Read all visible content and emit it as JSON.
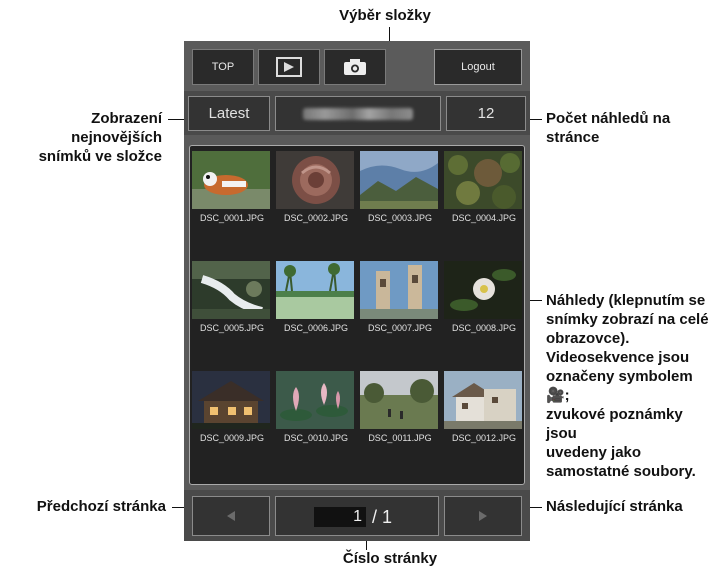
{
  "annotations": {
    "folder_select": "Výběr složky",
    "latest": [
      "Zobrazení nejnovějších",
      "snímků ve složce"
    ],
    "count": [
      "Počet náhledů na",
      "stránce"
    ],
    "thumbnails": [
      "Náhledy (klepnutím se",
      "snímky zobrazí na celé",
      "obrazovce).",
      "Videosekvence jsou",
      "označeny symbolem 🎥;",
      "zvukové poznámky jsou",
      "uvedeny jako",
      "samostatné soubory."
    ],
    "prev_page": "Předchozí stránka",
    "next_page": "Následující stránka",
    "page_number": "Číslo stránky"
  },
  "topbar": {
    "top_label": "TOP",
    "logout_label": "Logout"
  },
  "controls": {
    "latest_label": "Latest",
    "count_value": "12"
  },
  "thumbnails": [
    {
      "file": "DSC_0001.JPG"
    },
    {
      "file": "DSC_0002.JPG"
    },
    {
      "file": "DSC_0003.JPG"
    },
    {
      "file": "DSC_0004.JPG"
    },
    {
      "file": "DSC_0005.JPG"
    },
    {
      "file": "DSC_0006.JPG"
    },
    {
      "file": "DSC_0007.JPG"
    },
    {
      "file": "DSC_0008.JPG"
    },
    {
      "file": "DSC_0009.JPG"
    },
    {
      "file": "DSC_0010.JPG"
    },
    {
      "file": "DSC_0011.JPG"
    },
    {
      "file": "DSC_0012.JPG"
    }
  ],
  "pager": {
    "current": "1",
    "total": "/ 1"
  },
  "icons": {
    "prev": "triangle-left-icon",
    "next": "triangle-right-icon",
    "play": "playback-icon",
    "camera": "camera-icon"
  }
}
